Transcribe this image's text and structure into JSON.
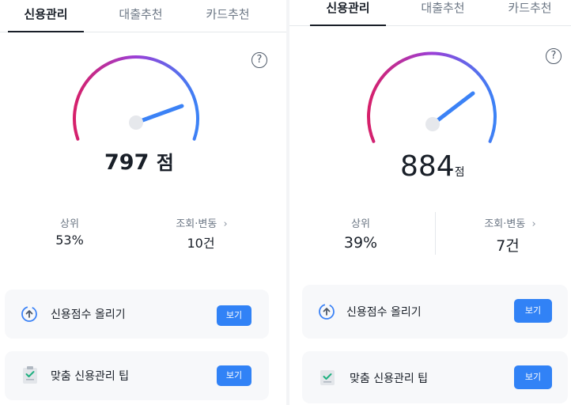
{
  "left": {
    "tabs": [
      {
        "label": "신용관리"
      },
      {
        "label": "대출추천"
      },
      {
        "label": "카드추천"
      }
    ],
    "help_icon": "?",
    "score": {
      "value": "797",
      "unit": "점"
    },
    "stats": {
      "rank_label": "상위",
      "rank_value": "53%",
      "history_label": "조회·변동",
      "history_chevron": "›",
      "history_value": "10건"
    },
    "cards": [
      {
        "title": "신용점수 올리기",
        "button": "보기",
        "icon": "arrow-up-circle-icon"
      },
      {
        "title": "맞춤 신용관리 팁",
        "button": "보기",
        "icon": "clipboard-check-icon"
      }
    ]
  },
  "right": {
    "tabs": [
      {
        "label": "신용관리"
      },
      {
        "label": "대출추천"
      },
      {
        "label": "카드추천"
      }
    ],
    "help_icon": "?",
    "score": {
      "value": "884",
      "unit": "점"
    },
    "stats": {
      "rank_label": "상위",
      "rank_value": "39%",
      "history_label": "조회·변동",
      "history_chevron": "›",
      "history_value": "7건"
    },
    "cards": [
      {
        "title": "신용점수 올리기",
        "button": "보기",
        "icon": "arrow-up-circle-icon"
      },
      {
        "title": "맞춤 신용관리 팁",
        "button": "보기",
        "icon": "clipboard-check-icon"
      }
    ]
  },
  "colors": {
    "gauge_start": "#d6206a",
    "gauge_mid": "#9b3fd6",
    "gauge_end": "#3b82f6",
    "needle": "#3b82f6",
    "button": "#3182f6"
  }
}
